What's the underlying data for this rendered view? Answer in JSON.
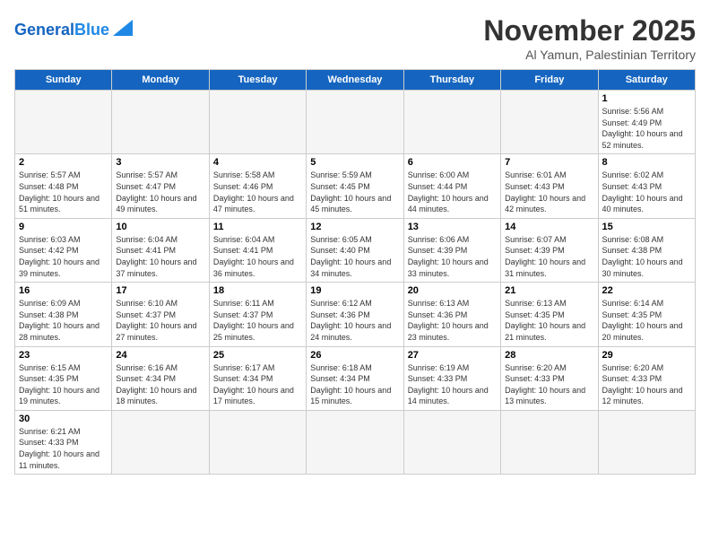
{
  "header": {
    "logo_general": "General",
    "logo_blue": "Blue",
    "month_title": "November 2025",
    "subtitle": "Al Yamun, Palestinian Territory"
  },
  "weekdays": [
    "Sunday",
    "Monday",
    "Tuesday",
    "Wednesday",
    "Thursday",
    "Friday",
    "Saturday"
  ],
  "days": [
    {
      "num": "",
      "info": "",
      "empty": true
    },
    {
      "num": "",
      "info": "",
      "empty": true
    },
    {
      "num": "",
      "info": "",
      "empty": true
    },
    {
      "num": "",
      "info": "",
      "empty": true
    },
    {
      "num": "",
      "info": "",
      "empty": true
    },
    {
      "num": "",
      "info": "",
      "empty": true
    },
    {
      "num": "1",
      "info": "Sunrise: 5:56 AM\nSunset: 4:49 PM\nDaylight: 10 hours and 52 minutes."
    },
    {
      "num": "2",
      "info": "Sunrise: 5:57 AM\nSunset: 4:48 PM\nDaylight: 10 hours and 51 minutes."
    },
    {
      "num": "3",
      "info": "Sunrise: 5:57 AM\nSunset: 4:47 PM\nDaylight: 10 hours and 49 minutes."
    },
    {
      "num": "4",
      "info": "Sunrise: 5:58 AM\nSunset: 4:46 PM\nDaylight: 10 hours and 47 minutes."
    },
    {
      "num": "5",
      "info": "Sunrise: 5:59 AM\nSunset: 4:45 PM\nDaylight: 10 hours and 45 minutes."
    },
    {
      "num": "6",
      "info": "Sunrise: 6:00 AM\nSunset: 4:44 PM\nDaylight: 10 hours and 44 minutes."
    },
    {
      "num": "7",
      "info": "Sunrise: 6:01 AM\nSunset: 4:43 PM\nDaylight: 10 hours and 42 minutes."
    },
    {
      "num": "8",
      "info": "Sunrise: 6:02 AM\nSunset: 4:43 PM\nDaylight: 10 hours and 40 minutes."
    },
    {
      "num": "9",
      "info": "Sunrise: 6:03 AM\nSunset: 4:42 PM\nDaylight: 10 hours and 39 minutes."
    },
    {
      "num": "10",
      "info": "Sunrise: 6:04 AM\nSunset: 4:41 PM\nDaylight: 10 hours and 37 minutes."
    },
    {
      "num": "11",
      "info": "Sunrise: 6:04 AM\nSunset: 4:41 PM\nDaylight: 10 hours and 36 minutes."
    },
    {
      "num": "12",
      "info": "Sunrise: 6:05 AM\nSunset: 4:40 PM\nDaylight: 10 hours and 34 minutes."
    },
    {
      "num": "13",
      "info": "Sunrise: 6:06 AM\nSunset: 4:39 PM\nDaylight: 10 hours and 33 minutes."
    },
    {
      "num": "14",
      "info": "Sunrise: 6:07 AM\nSunset: 4:39 PM\nDaylight: 10 hours and 31 minutes."
    },
    {
      "num": "15",
      "info": "Sunrise: 6:08 AM\nSunset: 4:38 PM\nDaylight: 10 hours and 30 minutes."
    },
    {
      "num": "16",
      "info": "Sunrise: 6:09 AM\nSunset: 4:38 PM\nDaylight: 10 hours and 28 minutes."
    },
    {
      "num": "17",
      "info": "Sunrise: 6:10 AM\nSunset: 4:37 PM\nDaylight: 10 hours and 27 minutes."
    },
    {
      "num": "18",
      "info": "Sunrise: 6:11 AM\nSunset: 4:37 PM\nDaylight: 10 hours and 25 minutes."
    },
    {
      "num": "19",
      "info": "Sunrise: 6:12 AM\nSunset: 4:36 PM\nDaylight: 10 hours and 24 minutes."
    },
    {
      "num": "20",
      "info": "Sunrise: 6:13 AM\nSunset: 4:36 PM\nDaylight: 10 hours and 23 minutes."
    },
    {
      "num": "21",
      "info": "Sunrise: 6:13 AM\nSunset: 4:35 PM\nDaylight: 10 hours and 21 minutes."
    },
    {
      "num": "22",
      "info": "Sunrise: 6:14 AM\nSunset: 4:35 PM\nDaylight: 10 hours and 20 minutes."
    },
    {
      "num": "23",
      "info": "Sunrise: 6:15 AM\nSunset: 4:35 PM\nDaylight: 10 hours and 19 minutes."
    },
    {
      "num": "24",
      "info": "Sunrise: 6:16 AM\nSunset: 4:34 PM\nDaylight: 10 hours and 18 minutes."
    },
    {
      "num": "25",
      "info": "Sunrise: 6:17 AM\nSunset: 4:34 PM\nDaylight: 10 hours and 17 minutes."
    },
    {
      "num": "26",
      "info": "Sunrise: 6:18 AM\nSunset: 4:34 PM\nDaylight: 10 hours and 15 minutes."
    },
    {
      "num": "27",
      "info": "Sunrise: 6:19 AM\nSunset: 4:33 PM\nDaylight: 10 hours and 14 minutes."
    },
    {
      "num": "28",
      "info": "Sunrise: 6:20 AM\nSunset: 4:33 PM\nDaylight: 10 hours and 13 minutes."
    },
    {
      "num": "29",
      "info": "Sunrise: 6:20 AM\nSunset: 4:33 PM\nDaylight: 10 hours and 12 minutes."
    },
    {
      "num": "30",
      "info": "Sunrise: 6:21 AM\nSunset: 4:33 PM\nDaylight: 10 hours and 11 minutes."
    },
    {
      "num": "",
      "info": "",
      "empty": true
    },
    {
      "num": "",
      "info": "",
      "empty": true
    },
    {
      "num": "",
      "info": "",
      "empty": true
    },
    {
      "num": "",
      "info": "",
      "empty": true
    },
    {
      "num": "",
      "info": "",
      "empty": true
    },
    {
      "num": "",
      "info": "",
      "empty": true
    }
  ]
}
